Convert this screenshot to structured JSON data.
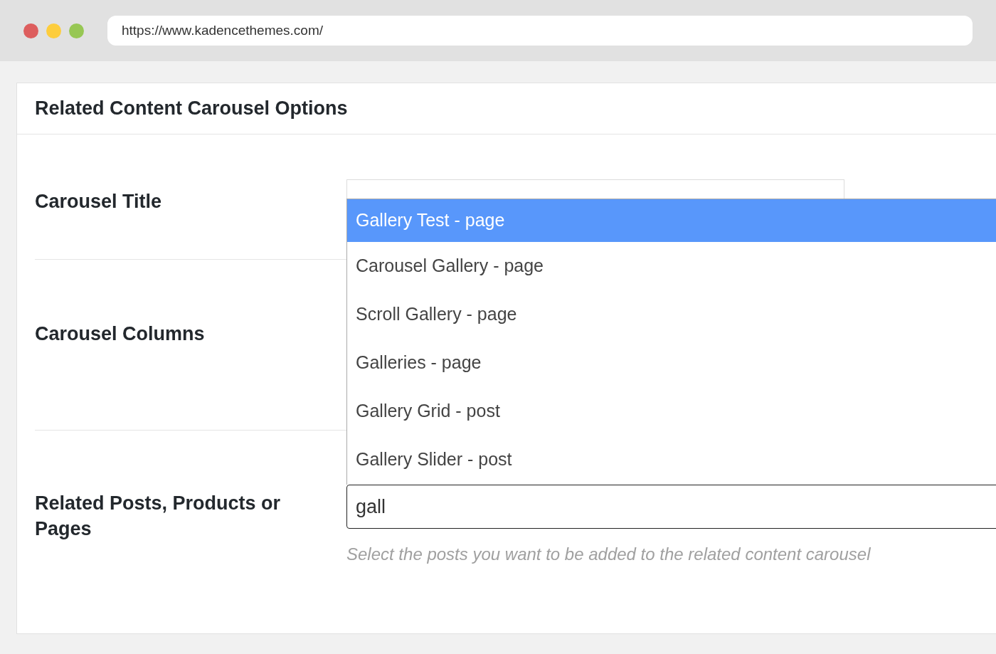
{
  "browser": {
    "url": "https://www.kadencethemes.com/"
  },
  "panel": {
    "title": "Related Content Carousel Options"
  },
  "fields": [
    {
      "label": "Carousel Title",
      "kind": "text"
    },
    {
      "label": "Carousel Columns",
      "kind": "covered"
    },
    {
      "label": "Related Posts, Products or Pages",
      "kind": "search",
      "value": "gall",
      "hint": "Select the posts you want to be added to the related content carousel",
      "results": [
        {
          "label": "Gallery Test - page",
          "selected": true
        },
        {
          "label": "Carousel Gallery - page",
          "selected": false
        },
        {
          "label": "Scroll Gallery - page",
          "selected": false
        },
        {
          "label": "Galleries - page",
          "selected": false
        },
        {
          "label": "Gallery Grid - post",
          "selected": false
        },
        {
          "label": "Gallery Slider - post",
          "selected": false
        }
      ]
    }
  ]
}
